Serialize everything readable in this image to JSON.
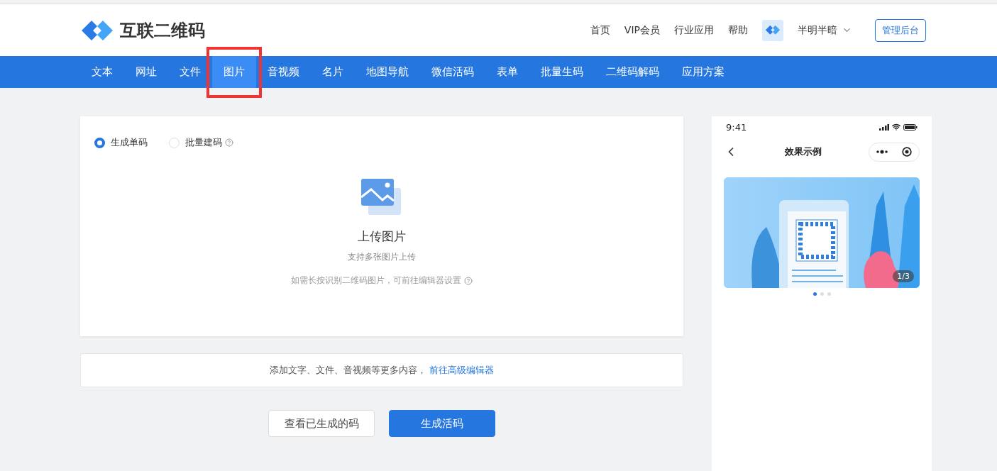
{
  "logo": {
    "text": "互联二维码"
  },
  "top_nav": [
    "首页",
    "VIP会员",
    "行业应用",
    "帮助"
  ],
  "user": {
    "name": "半明半暗"
  },
  "admin_button": "管理后台",
  "tabs": [
    {
      "label": "文本",
      "selected": false,
      "highlighted": false
    },
    {
      "label": "网址",
      "selected": false,
      "highlighted": false
    },
    {
      "label": "文件",
      "selected": false,
      "highlighted": false
    },
    {
      "label": "图片",
      "selected": true,
      "highlighted": true
    },
    {
      "label": "音视频",
      "selected": false,
      "highlighted": false
    },
    {
      "label": "名片",
      "selected": false,
      "highlighted": false
    },
    {
      "label": "地图导航",
      "selected": false,
      "highlighted": false
    },
    {
      "label": "微信活码",
      "selected": false,
      "highlighted": false
    },
    {
      "label": "表单",
      "selected": false,
      "highlighted": false
    },
    {
      "label": "批量生码",
      "selected": false,
      "highlighted": false
    },
    {
      "label": "二维码解码",
      "selected": false,
      "highlighted": false
    },
    {
      "label": "应用方案",
      "selected": false,
      "highlighted": false
    }
  ],
  "modes": [
    {
      "label": "生成单码",
      "selected": true,
      "help": false
    },
    {
      "label": "批量建码",
      "selected": false,
      "help": true
    }
  ],
  "upload": {
    "title": "上传图片",
    "subtitle": "支持多张图片上传",
    "hint": "如需长按识别二维码图片，可前往编辑器设置"
  },
  "more": {
    "text": "添加文字、文件、音视频等更多内容，",
    "link": "前往高级编辑器"
  },
  "buttons": [
    {
      "label": "查看已生成的码",
      "kind": "secondary"
    },
    {
      "label": "生成活码",
      "kind": "primary"
    }
  ],
  "preview": {
    "time": "9:41",
    "title": "效果示例",
    "counter": "1/3",
    "dots": [
      {
        "selected": true
      },
      {
        "selected": false
      },
      {
        "selected": false
      }
    ]
  }
}
